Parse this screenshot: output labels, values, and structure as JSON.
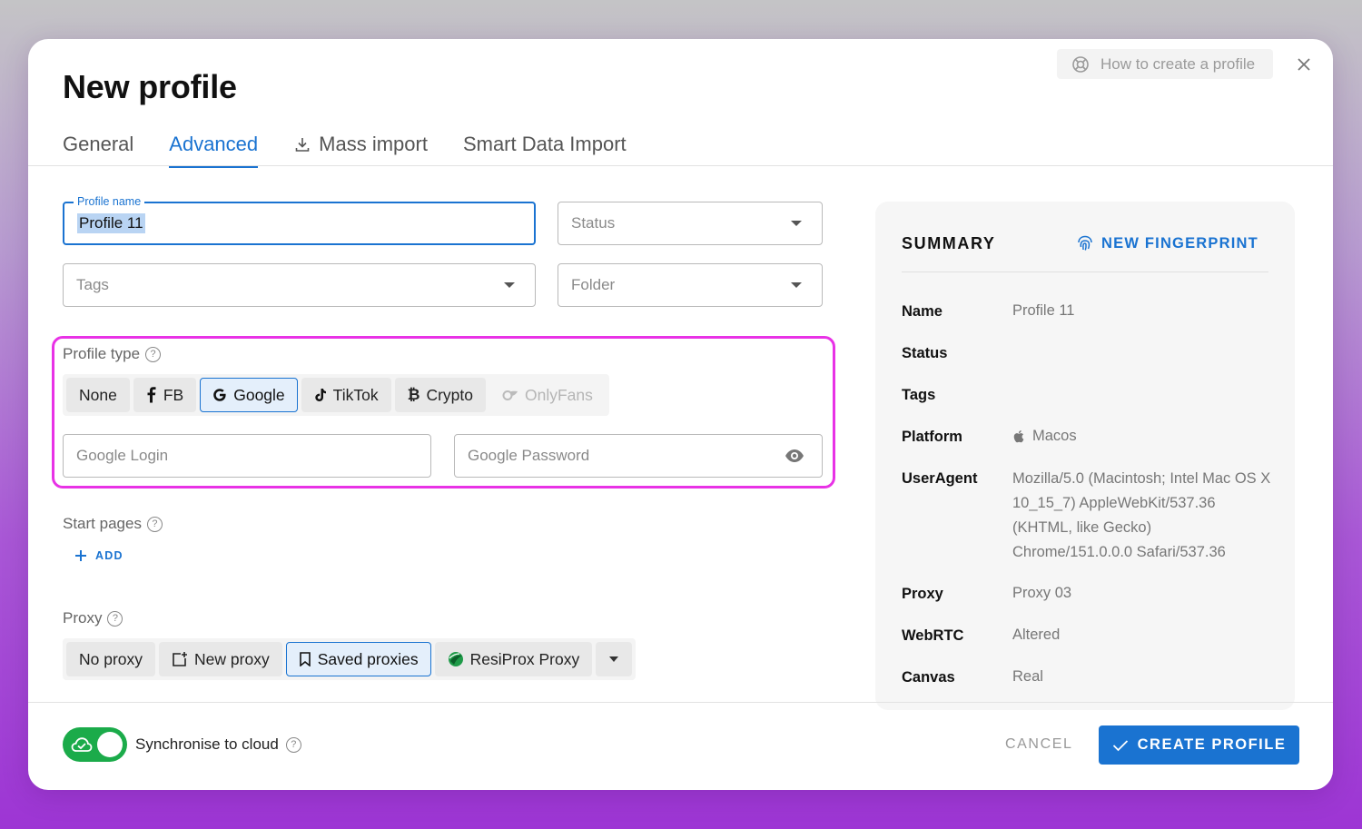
{
  "dialog": {
    "title": "New profile",
    "help_link": "How to create a profile"
  },
  "tabs": [
    {
      "label": "General",
      "active": false
    },
    {
      "label": "Advanced",
      "active": true
    },
    {
      "label": "Mass import",
      "icon": "download-icon",
      "active": false
    },
    {
      "label": "Smart Data Import",
      "active": false
    }
  ],
  "form": {
    "profile_name": {
      "label": "Profile name",
      "value": "Profile 11"
    },
    "status": {
      "placeholder": "Status"
    },
    "tags": {
      "placeholder": "Tags"
    },
    "folder": {
      "placeholder": "Folder"
    },
    "profile_type": {
      "label": "Profile type",
      "options": [
        {
          "label": "None",
          "icon": ""
        },
        {
          "label": "FB",
          "icon": "facebook-icon"
        },
        {
          "label": "Google",
          "icon": "google-icon",
          "selected": true
        },
        {
          "label": "TikTok",
          "icon": "tiktok-icon"
        },
        {
          "label": "Crypto",
          "icon": "bitcoin-icon"
        },
        {
          "label": "OnlyFans",
          "icon": "onlyfans-icon",
          "disabled": true
        }
      ],
      "google_login": {
        "placeholder": "Google Login"
      },
      "google_password": {
        "placeholder": "Google Password"
      }
    },
    "start_pages": {
      "label": "Start pages",
      "add_label": "ADD"
    },
    "proxy": {
      "label": "Proxy",
      "options": [
        {
          "label": "No proxy"
        },
        {
          "label": "New proxy",
          "icon": "add-proxy-icon"
        },
        {
          "label": "Saved proxies",
          "icon": "bookmark-icon",
          "selected": true
        },
        {
          "label": "ResiProx Proxy",
          "icon": "resiprox-icon"
        }
      ]
    }
  },
  "summary": {
    "title": "SUMMARY",
    "new_fingerprint": "NEW FINGERPRINT",
    "rows": [
      {
        "key": "Name",
        "value": "Profile 11"
      },
      {
        "key": "Status",
        "value": ""
      },
      {
        "key": "Tags",
        "value": ""
      },
      {
        "key": "Platform",
        "value": "Macos"
      },
      {
        "key": "UserAgent",
        "value": "Mozilla/5.0 (Macintosh; Intel Mac OS X 10_15_7) AppleWebKit/537.36 (KHTML, like Gecko) Chrome/151.0.0.0 Safari/537.36"
      },
      {
        "key": "Proxy",
        "value": "Proxy 03"
      },
      {
        "key": "WebRTC",
        "value": "Altered"
      },
      {
        "key": "Canvas",
        "value": "Real"
      }
    ]
  },
  "footer": {
    "sync_label": "Synchronise to cloud",
    "sync_enabled": true,
    "cancel_label": "CANCEL",
    "create_label": "CREATE PROFILE"
  },
  "colors": {
    "accent": "#1a73d1",
    "highlight": "#e832e6",
    "toggle_on": "#1bab4a"
  }
}
